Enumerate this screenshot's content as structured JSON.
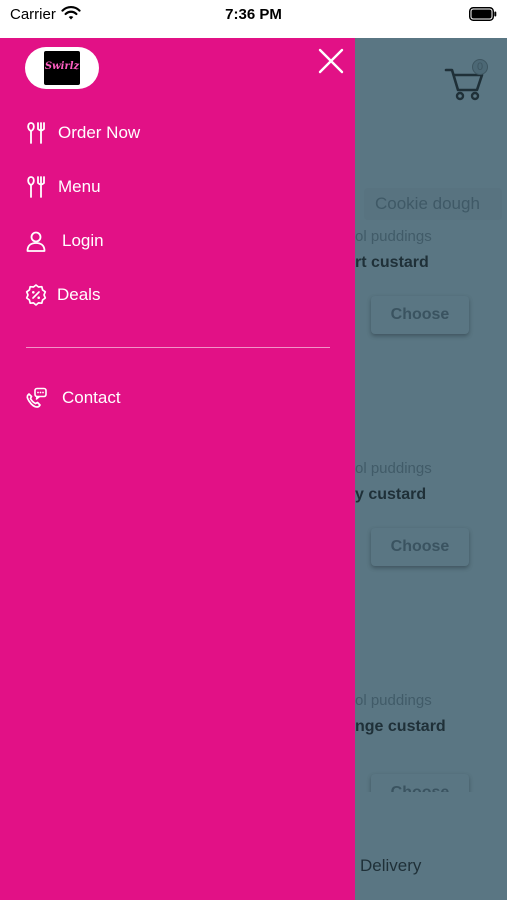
{
  "status_bar": {
    "carrier": "Carrier",
    "time": "7:36 PM"
  },
  "drawer": {
    "brand_logo_text": "Swirlz",
    "menu": [
      {
        "label": "Order Now",
        "icon": "utensils-icon"
      },
      {
        "label": "Menu",
        "icon": "utensils-icon"
      },
      {
        "label": "Login",
        "icon": "user-icon"
      },
      {
        "label": "Deals",
        "icon": "discount-badge-icon"
      }
    ],
    "contact": {
      "label": "Contact",
      "icon": "phone-chat-icon"
    }
  },
  "background": {
    "cart_count": "0",
    "category_chip": "Cookie dough",
    "products": [
      {
        "category": "ol puddings",
        "name": "rt custard",
        "button": "Choose"
      },
      {
        "category": "ol puddings",
        "name": "y custard",
        "button": "Choose"
      },
      {
        "category": "ol puddings",
        "name": "nge custard",
        "button": "Choose"
      }
    ],
    "bottom_tab": "Delivery"
  },
  "colors": {
    "drawer_bg": "#e21186",
    "overlay": "#5a7683",
    "text_on_drawer": "#ffffff"
  }
}
